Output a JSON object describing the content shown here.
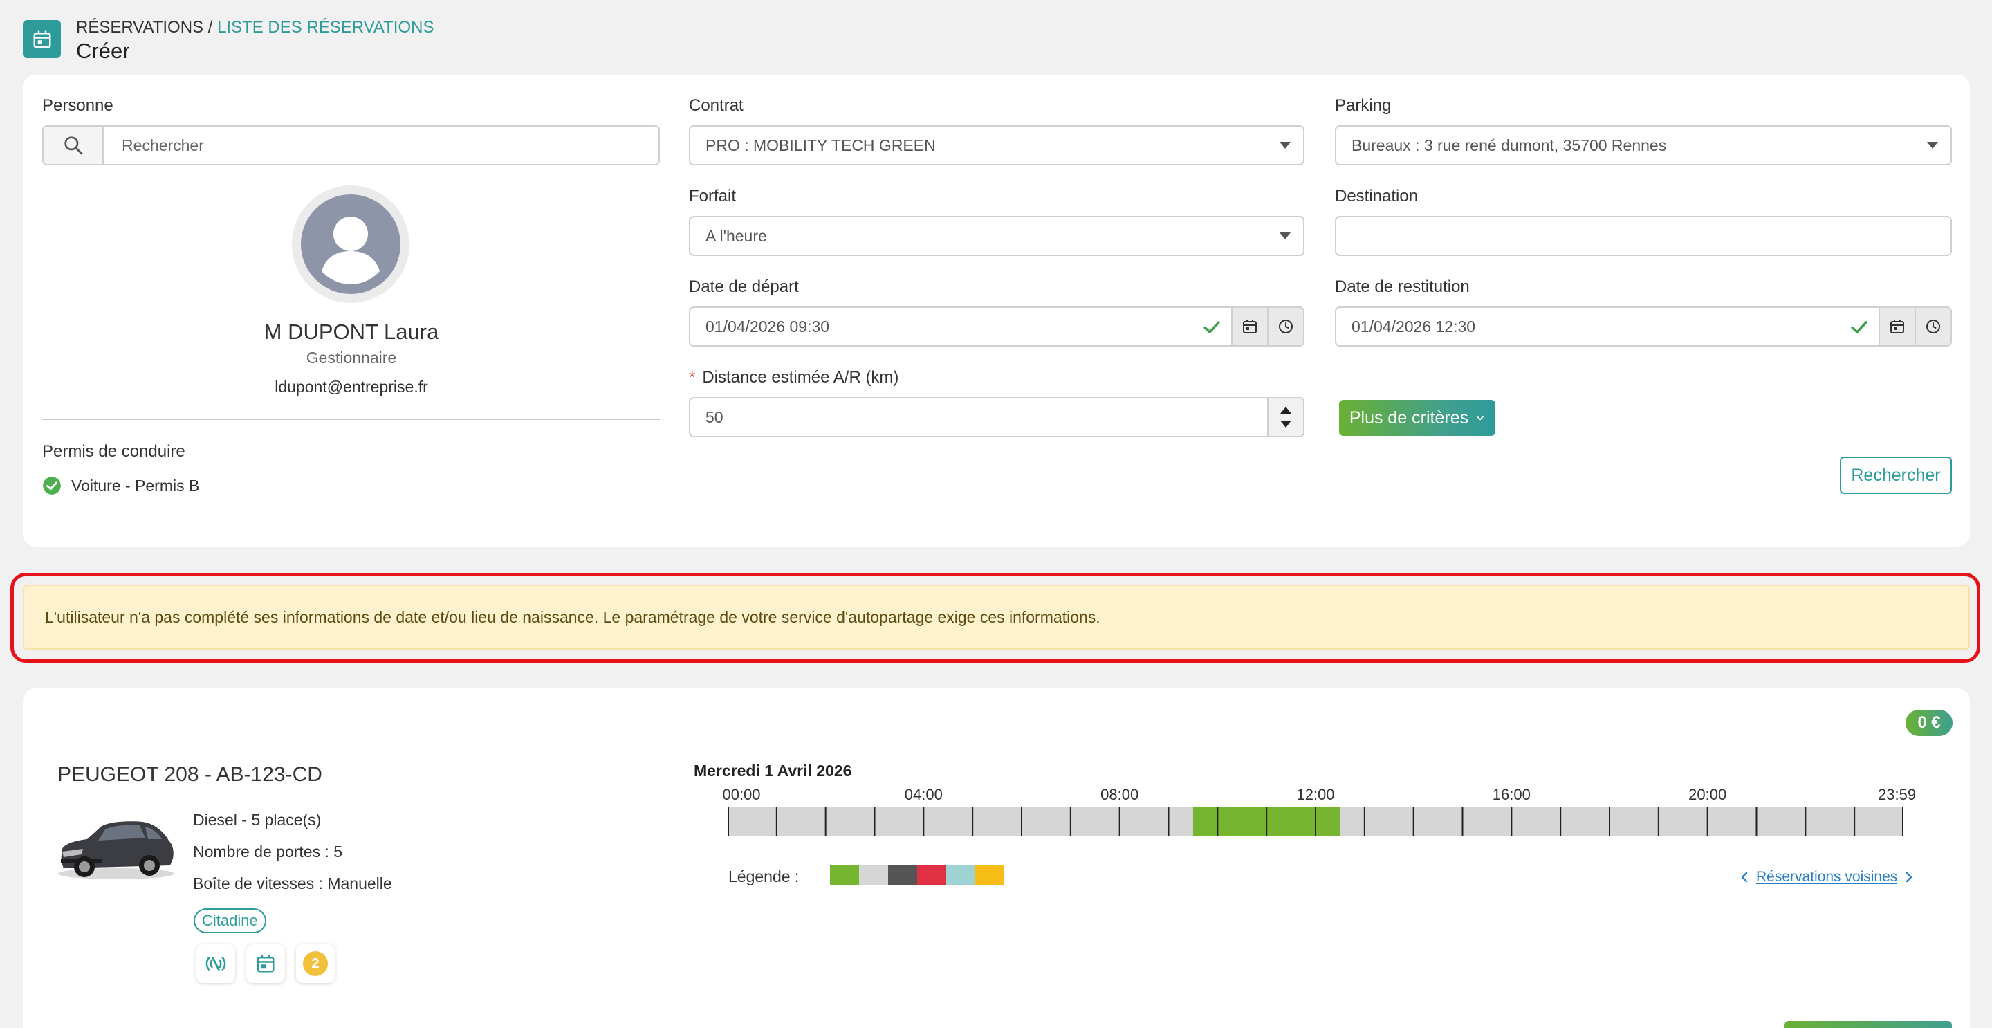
{
  "header": {
    "breadcrumb_root": "RÉSERVATIONS",
    "breadcrumb_sep": " / ",
    "breadcrumb_link": "LISTE DES RÉSERVATIONS",
    "title": "Créer",
    "icon": "calendar-icon"
  },
  "form": {
    "person": {
      "label": "Personne",
      "search_placeholder": "Rechercher",
      "name": "M DUPONT Laura",
      "role": "Gestionnaire",
      "email": "ldupont@entreprise.fr",
      "license_label": "Permis de conduire",
      "license_value": "Voiture - Permis B"
    },
    "contract": {
      "label": "Contrat",
      "value": "PRO : MOBILITY TECH GREEN"
    },
    "parking": {
      "label": "Parking",
      "value": "Bureaux : 3 rue rené dumont, 35700 Rennes"
    },
    "forfait": {
      "label": "Forfait",
      "value": "A l'heure"
    },
    "destination": {
      "label": "Destination",
      "value": ""
    },
    "departure": {
      "label": "Date de départ",
      "value": "01/04/2026 09:30"
    },
    "return": {
      "label": "Date de restitution",
      "value": "01/04/2026 12:30"
    },
    "distance": {
      "required_mark": "*",
      "label": "Distance estimée A/R (km)",
      "value": "50"
    },
    "more_criteria_label": "Plus de critères",
    "search_button_label": "Rechercher"
  },
  "warning": {
    "text": "L'utilisateur n'a pas complété ses informations de date et/ou lieu de naissance. Le paramétrage de votre service d'autopartage exige ces informations."
  },
  "vehicle": {
    "price": "0 €",
    "title": "PEUGEOT 208 - AB-123-CD",
    "specs": [
      "Diesel - 5 place(s)",
      "Nombre de portes : 5",
      "Boîte de vitesses : Manuelle"
    ],
    "tag": "Citadine",
    "badge_count": "2",
    "feature_icons": [
      "no-signal-icon",
      "calendar-icon",
      "coin-icon"
    ]
  },
  "timeline": {
    "date": "Mercredi 1 Avril 2026",
    "tick_labels": [
      "00:00",
      "04:00",
      "08:00",
      "12:00",
      "16:00",
      "20:00",
      "23:59"
    ],
    "hours_total": 24,
    "booked_from_hour": 9.5,
    "booked_to_hour": 12.5,
    "legend_label": "Légende :",
    "legend_colors": [
      "#76b52f",
      "#d6d6d6",
      "#555555",
      "#e03144",
      "#9fd2d2",
      "#f6bd16"
    ],
    "neighbors_link": "Réservations voisines"
  },
  "colors": {
    "accent": "#2e9b9b",
    "green": "#76b52f",
    "warning_bg": "#fdf2cd",
    "highlight_border": "#e8111a"
  }
}
